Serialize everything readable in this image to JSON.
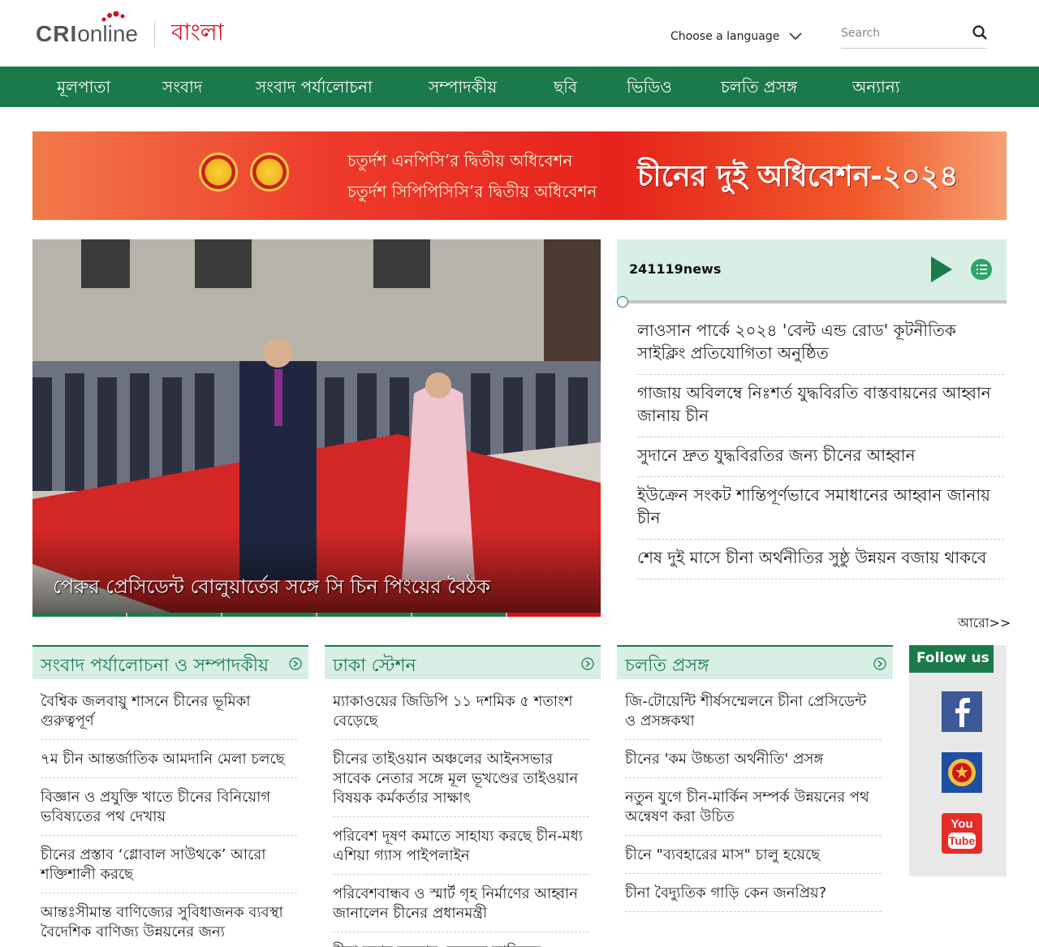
{
  "header": {
    "logo_cri": "CRI",
    "logo_online": "online",
    "logo_bangla": "বাংলা",
    "language_label": "Choose a language",
    "search_placeholder": "Search"
  },
  "nav": {
    "items": [
      "মূলপাতা",
      "সংবাদ",
      "সংবাদ পর্যালোচনা",
      "সম্পাদকীয়",
      "ছবি",
      "ভিডিও",
      "চলতি প্রসঙ্গ",
      "অন্যান্য"
    ]
  },
  "banner": {
    "line1": "চতুর্দশ এনপিসি’র দ্বিতীয় অধিবেশন",
    "line2": "চতুর্দশ সিপিপিসিসি’র দ্বিতীয় অধিবেশন",
    "title": "চীনের দুই অধিবেশন-২০২৪"
  },
  "hero": {
    "caption": "পেরুর প্রেসিডেন্ট বোলুয়ার্তের সঙ্গে সি চিন পিংয়ের বৈঠক"
  },
  "audio": {
    "title": "241119news"
  },
  "news": {
    "items": [
      "লাওসান পার্কে ২০২৪ 'বেল্ট এন্ড রোড' কূটনীতিক সাইক্লিং প্রতিযোগিতা অনুষ্ঠিত",
      "গাজায় অবিলম্বে নিঃশর্ত যুদ্ধবিরতি বাস্তবায়নের আহ্বান জানায় চীন",
      "সুদানে দ্রুত যুদ্ধবিরতির জন্য চীনের আহ্বান",
      "ইউক্রেন সংকট শান্তিপূর্ণভাবে সমাধানের আহ্বান জানায় চীন",
      "শেষ দুই মাসে চীনা অর্থনীতির সুষ্ঠু উন্নয়ন বজায় থাকবে"
    ],
    "more": "আরো>>"
  },
  "columns": [
    {
      "title": "সংবাদ পর্যালোচনা ও সম্পাদকীয়",
      "items": [
        "বৈশ্বিক জলবায়ু শাসনে চীনের ভূমিকা গুরুত্বপূর্ণ",
        "৭ম চীন আন্তর্জাতিক আমদানি মেলা চলছে",
        "বিজ্ঞান ও প্রযুক্তি খাতে চীনের বিনিয়োগ ভবিষ্যতের পথ দেখায়",
        "চীনের প্রস্তাব ‘গ্লোবাল সাউথকে’ আরো শক্তিশালী করছে",
        "আন্তঃসীমান্ত বাণিজ্যের সুবিধাজনক ব্যবস্থা বৈদেশিক বাণিজ্য উন্নয়নের জন্য"
      ]
    },
    {
      "title": "ঢাকা স্টেশন",
      "items": [
        "ম্যাকাওয়ের জিডিপি ১১ দশমিক ৫ শতাংশ বেড়েছে",
        "চীনের তাইওয়ান অঞ্চলের আইনসভার সাবেক নেতার সঙ্গে মূল ভূখণ্ডের তাইওয়ান বিষয়ক কর্মকর্তার সাক্ষাৎ",
        "পরিবেশ দূষণ কমাতে সাহায্য করছে চীন-মধ্য এশিয়া গ্যাস পাইপলাইন",
        "পরিবেশবান্ধব ও স্মার্ট গৃহ নির্মাণের আহ্বান জানালেন চীনের প্রধানমন্ত্রী",
        "চীনা মুদ্রার ব্যবহার বেড়েছে ব্রাজিলে"
      ]
    },
    {
      "title": "চলতি প্রসঙ্গ",
      "items": [
        "জি-টোয়েন্টি শীর্ষসম্মেলনে চীনা প্রেসিডেন্ট ও প্রসঙ্গকথা",
        "চীনের 'কম উচ্চতা অর্থনীতি' প্রসঙ্গ",
        "নতুন যুগে চীন-মার্কিন সম্পর্ক উন্নয়নের পথ অন্বেষণ করা উচিত",
        "চীনে \"ব্যবহারের মাস\" চালু হয়েছে",
        "চীনা বৈদ্যুতিক গাড়ি কেন জনপ্রিয়?"
      ]
    }
  ],
  "follow": {
    "title": "Follow us",
    "youtube_you": "You",
    "youtube_tube": "Tube"
  },
  "colors": {
    "brand_green": "#1b7a4a",
    "brand_red": "#d0121b",
    "panel_green": "#d8efe5"
  }
}
